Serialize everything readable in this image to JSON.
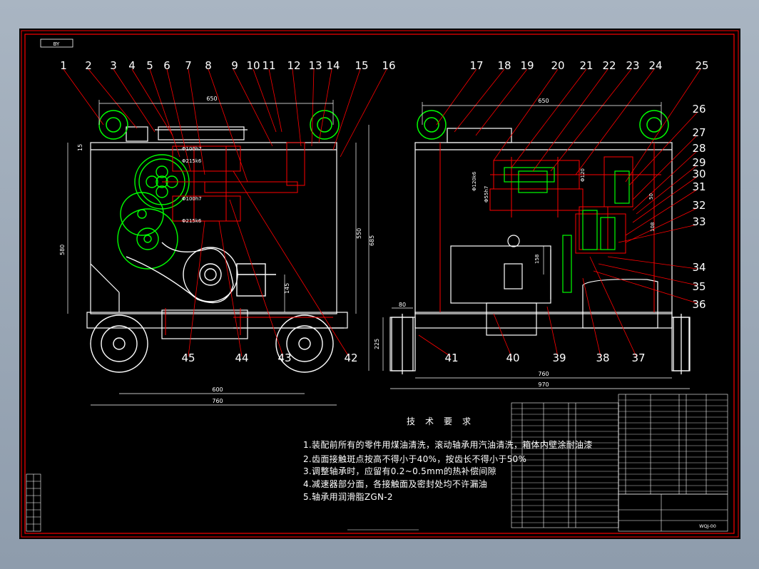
{
  "sheet_tag": "BY",
  "front_view": {
    "part_numbers_top": [
      "1",
      "2",
      "3",
      "4",
      "5",
      "6",
      "7",
      "8",
      "9",
      "10",
      "11",
      "12",
      "13",
      "14",
      "15",
      "16"
    ],
    "part_numbers_bottom": [
      "45",
      "44",
      "43",
      "42"
    ],
    "dims": {
      "width_top": "650",
      "gap_left": "15",
      "height_left": "580",
      "height_right_1": "550",
      "height_right_2": "685",
      "motor_height": "145",
      "width_600": "600",
      "width_760": "760",
      "dia_100h7_a": "Φ100h7",
      "dia_215k6_a": "Φ215k6",
      "dia_100h7_b": "Φ100h7",
      "dia_215k6_b": "Φ215k6"
    }
  },
  "side_view": {
    "part_numbers_top": [
      "17",
      "18",
      "19",
      "20",
      "21",
      "22",
      "23",
      "24",
      "25"
    ],
    "part_numbers_right": [
      "26",
      "27",
      "28",
      "29",
      "30",
      "31",
      "32",
      "33",
      "34",
      "35",
      "36"
    ],
    "part_numbers_bottom": [
      "41",
      "40",
      "39",
      "38",
      "37"
    ],
    "dims": {
      "width_top": "650",
      "dia_120k6": "Φ120k6",
      "dia_55h7": "Φ55h7",
      "dia_120": "Φ120",
      "dim_50": "50",
      "dim_108": "108",
      "dim_158": "158",
      "dim_80": "80",
      "dim_225": "225",
      "width_760": "760",
      "width_970": "970"
    }
  },
  "technical_requirements": {
    "title": "技术要求",
    "items": [
      "1.装配前所有的零件用煤油清洗，滚动轴承用汽油清洗，箱体内壁涂耐油漆",
      "2.齿面接触斑点按高不得小于40%，按齿长不得小于50%",
      "3.调整轴承时，应留有0.2~0.5mm的热补偿间隙",
      "4.减速器部分面，各接触面及密封处均不许漏油",
      "5.轴承用润滑脂ZGN-2"
    ]
  },
  "title_block": {
    "drawing_no": "WQJ-00"
  },
  "colors": {
    "frame": "#ff0000",
    "geometry": "#ffffff",
    "gears": "#00ff00",
    "leader": "#ff0000",
    "hatch": "#ff0000",
    "dims": "#ffffff",
    "centerline": "#ff0000"
  }
}
